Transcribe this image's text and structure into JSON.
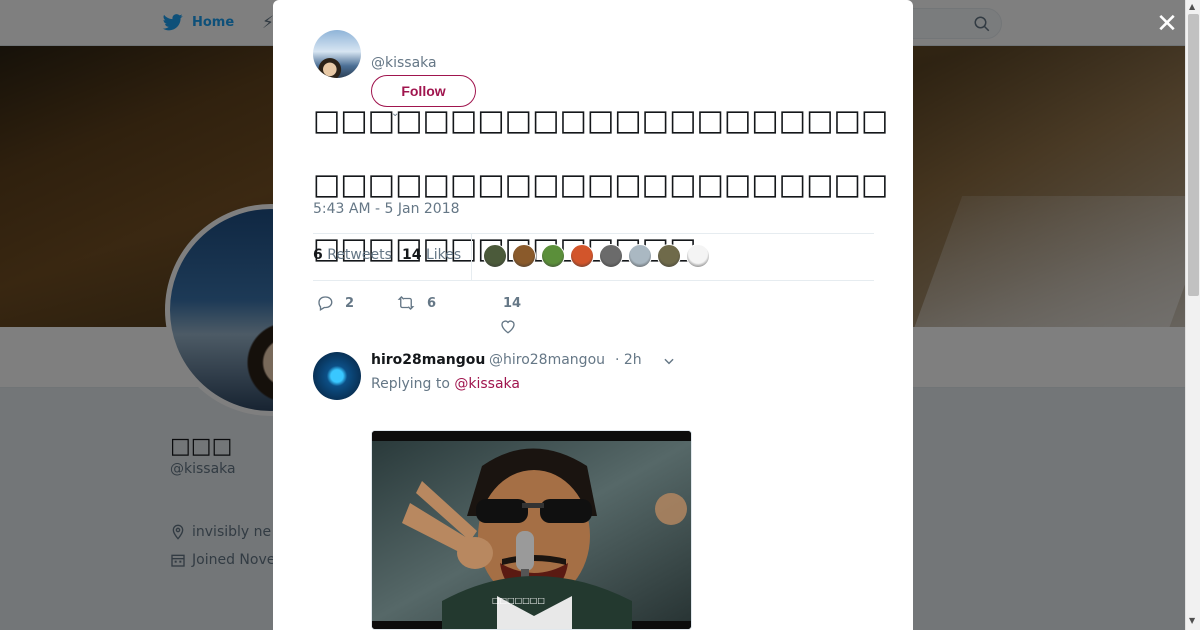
{
  "nav": {
    "home_label": "Home",
    "brand_color": "#1da1f2",
    "accent_color": "#a0154e"
  },
  "background_profile": {
    "name": "□□□",
    "handle": "@kissaka",
    "location": "invisibly ne",
    "joined": "Joined Nove"
  },
  "modal": {
    "close_label": "✕",
    "author_handle": "@kissaka",
    "follow_label": "Follow",
    "tweet_text": "□□□□□□□□□□□□□□□□□□□□□□□□□□□□□□□□□□□□□□□□□□□□□□□□□□□□□□□□",
    "timestamp": "5:43 AM - 5 Jan 2018",
    "retweets_count": "6",
    "retweets_label": "Retweets",
    "likes_count": "14",
    "likes_label": "Likes",
    "liker_colors": [
      "#4b5a3a",
      "#8a5a2b",
      "#5b8f3a",
      "#d2552b",
      "#6b6b6b",
      "#aab8c2",
      "#6f6a4a",
      "#f4f4f4"
    ],
    "reply_count": "2",
    "retweet_count": "6",
    "like_count": "14"
  },
  "reply": {
    "name": "hiro28mangou",
    "handle": "@hiro28mangou",
    "time": "· 2h",
    "replying_prefix": "Replying to",
    "replying_to": "@kissaka",
    "media_caption": "□□□□□□□"
  }
}
